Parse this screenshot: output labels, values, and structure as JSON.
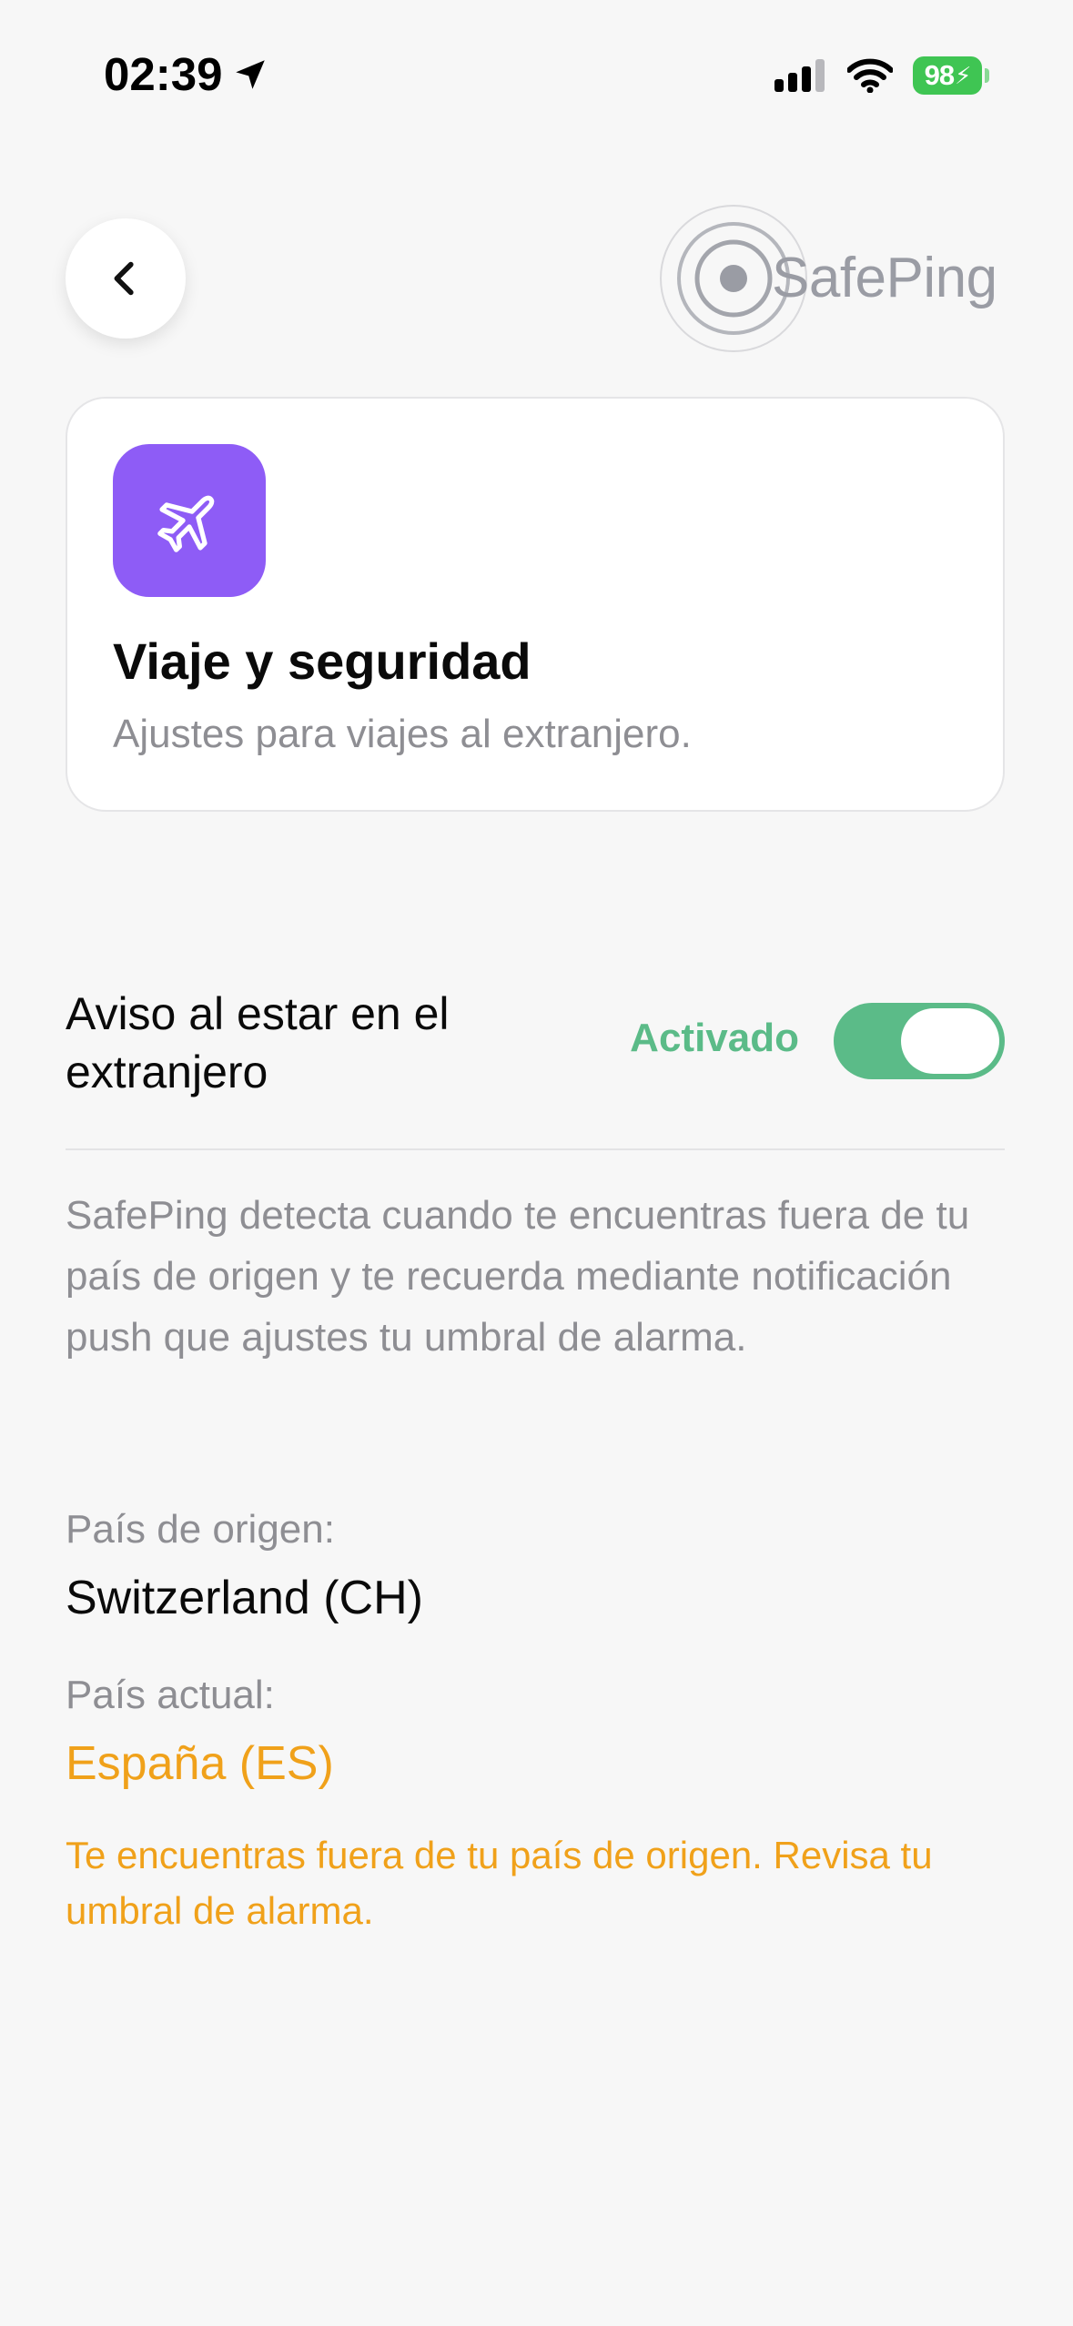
{
  "status_bar": {
    "time": "02:39",
    "battery_level": "98",
    "icons": [
      "location-arrow-icon",
      "cellular-signal-icon",
      "wifi-icon",
      "battery-charging-icon"
    ]
  },
  "header": {
    "back_icon": "chevron-left-icon",
    "brand_name": "SafePing"
  },
  "hero": {
    "icon": "airplane-icon",
    "title": "Viaje y seguridad",
    "subtitle": "Ajustes para viajes al extranjero."
  },
  "setting": {
    "label": "Aviso al estar en el extranjero",
    "status": "Activado",
    "enabled": true
  },
  "description": "SafePing detecta cuando te encuentras fuera de tu país de origen y te recuerda mediante notificación push que ajustes tu umbral de alarma.",
  "origin": {
    "label": "País de origen:",
    "value": "Switzerland (CH)"
  },
  "current": {
    "label": "País actual:",
    "value": "España (ES)"
  },
  "warning": "Te encuentras fuera de tu país de origen. Revisa tu umbral de alarma.",
  "colors": {
    "accent_purple": "#8e5cf6",
    "toggle_green": "#5bbb88",
    "warning_orange": "#f0a11a",
    "battery_green": "#3fc553"
  }
}
